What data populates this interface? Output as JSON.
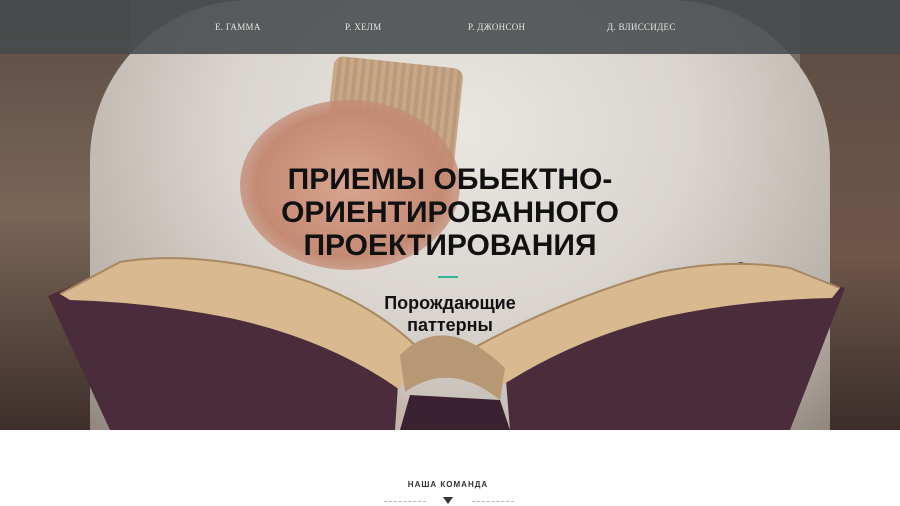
{
  "nav": {
    "items": [
      {
        "label": "Е. ГАММА"
      },
      {
        "label": "Р. ХЕЛМ"
      },
      {
        "label": "Р. ДЖОНСОН"
      },
      {
        "label": "Д. ВЛИССИДЕС"
      }
    ]
  },
  "hero": {
    "title": "ПРИЕМЫ ОБЬЕКТНО-ОРИЕНТИРОВАННОГО ПРОЕКТИРОВАНИЯ",
    "subtitle": "Порождающие паттерны",
    "accent_color": "#2fb59a"
  },
  "team": {
    "heading": "НАША КОМАНДА",
    "scroll_icon": "chevron-down-icon"
  }
}
